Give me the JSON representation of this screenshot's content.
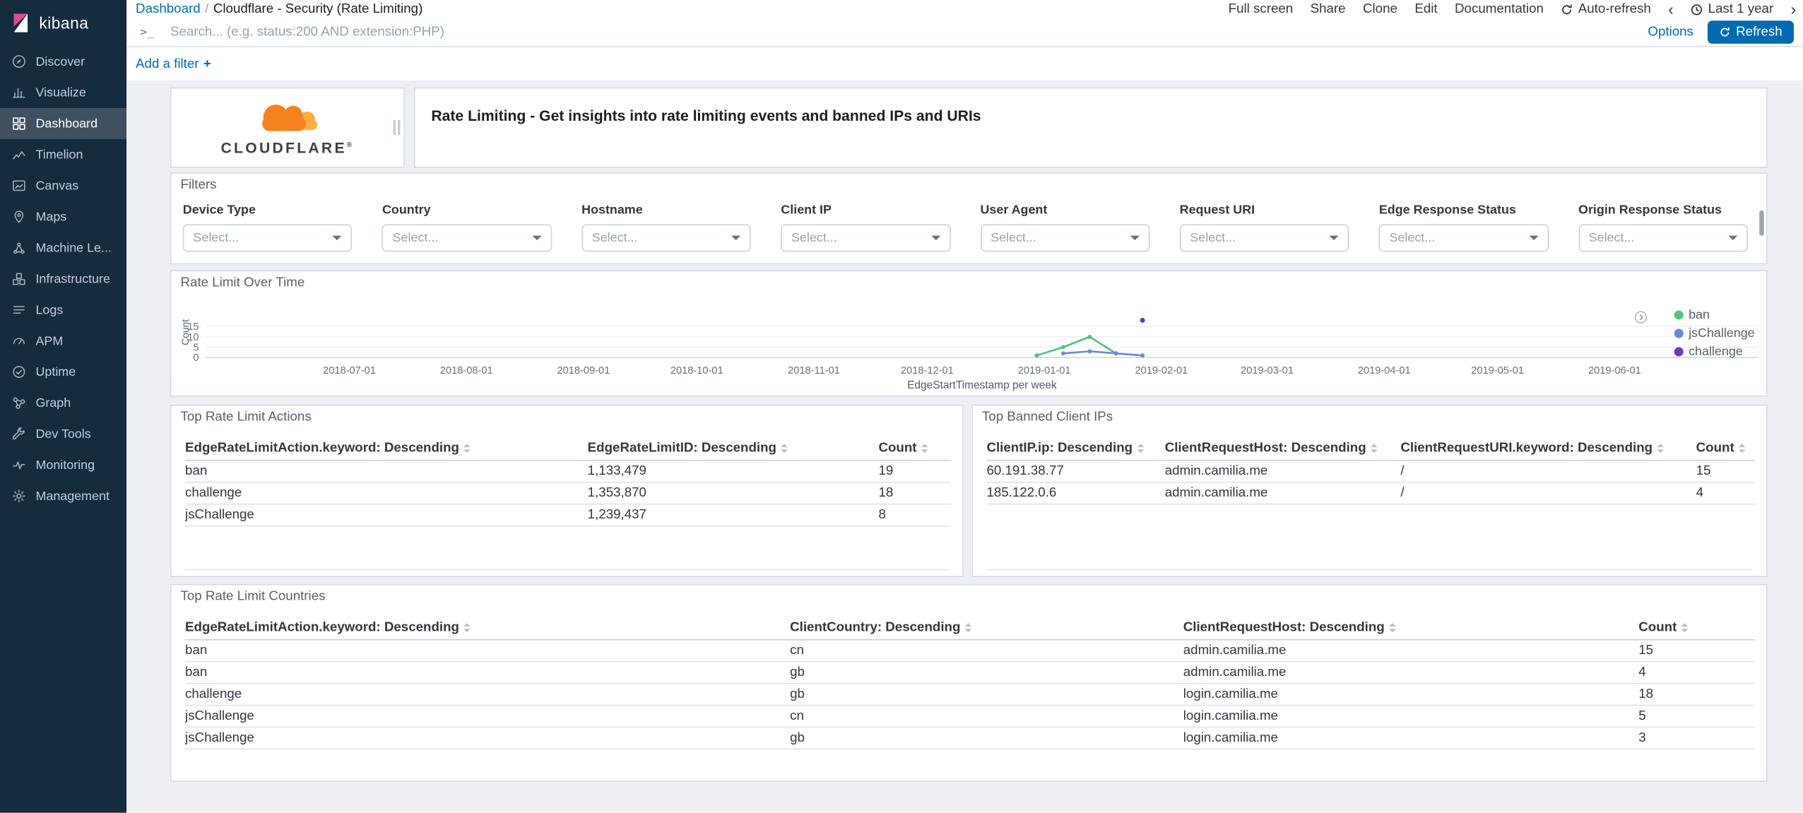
{
  "app": {
    "name": "kibana"
  },
  "sidebar": {
    "logo_label": "kibana",
    "items": [
      {
        "label": "Discover",
        "icon": "discover-icon"
      },
      {
        "label": "Visualize",
        "icon": "visualize-icon"
      },
      {
        "label": "Dashboard",
        "icon": "dashboard-icon",
        "active": true
      },
      {
        "label": "Timelion",
        "icon": "timelion-icon"
      },
      {
        "label": "Canvas",
        "icon": "canvas-icon"
      },
      {
        "label": "Maps",
        "icon": "maps-icon"
      },
      {
        "label": "Machine Le...",
        "icon": "machine-learning-icon"
      },
      {
        "label": "Infrastructure",
        "icon": "infrastructure-icon"
      },
      {
        "label": "Logs",
        "icon": "logs-icon"
      },
      {
        "label": "APM",
        "icon": "apm-icon"
      },
      {
        "label": "Uptime",
        "icon": "uptime-icon"
      },
      {
        "label": "Graph",
        "icon": "graph-icon"
      },
      {
        "label": "Dev Tools",
        "icon": "dev-tools-icon"
      },
      {
        "label": "Monitoring",
        "icon": "monitoring-icon"
      },
      {
        "label": "Management",
        "icon": "management-icon"
      }
    ]
  },
  "topnav": {
    "breadcrumb": {
      "link": "Dashboard",
      "separator": "/",
      "current": "Cloudflare - Security (Rate Limiting)"
    },
    "menu": [
      "Full screen",
      "Share",
      "Clone",
      "Edit",
      "Documentation"
    ],
    "auto_refresh": "Auto-refresh",
    "prev": "‹",
    "next": "›",
    "time_range": "Last 1 year"
  },
  "query_bar": {
    "prompt": ">_",
    "placeholder": "Search... (e.g. status:200 AND extension:PHP)",
    "options": "Options",
    "refresh": "Refresh"
  },
  "filter_bar": {
    "add_filter": "Add a filter",
    "plus": "+"
  },
  "panels": {
    "cloudflare": {
      "brand": "CLOUDFLARE",
      "reg": "®"
    },
    "markdown": {
      "text": "Rate Limiting - Get insights into rate limiting events and banned IPs and URIs"
    },
    "filters": {
      "title": "Filters",
      "fields": [
        {
          "label": "Device Type",
          "placeholder": "Select..."
        },
        {
          "label": "Country",
          "placeholder": "Select..."
        },
        {
          "label": "Hostname",
          "placeholder": "Select..."
        },
        {
          "label": "Client IP",
          "placeholder": "Select..."
        },
        {
          "label": "User Agent",
          "placeholder": "Select..."
        },
        {
          "label": "Request URI",
          "placeholder": "Select..."
        },
        {
          "label": "Edge Response Status",
          "placeholder": "Select..."
        },
        {
          "label": "Origin Response Status",
          "placeholder": "Select..."
        }
      ]
    },
    "over_time": {
      "title": "Rate Limit Over Time"
    },
    "top_actions": {
      "title": "Top Rate Limit Actions",
      "columns": [
        "EdgeRateLimitAction.keyword: Descending",
        "EdgeRateLimitID: Descending",
        "Count"
      ],
      "rows": [
        [
          "ban",
          "1,133,479",
          "19"
        ],
        [
          "challenge",
          "1,353,870",
          "18"
        ],
        [
          "jsChallenge",
          "1,239,437",
          "8"
        ]
      ]
    },
    "top_banned": {
      "title": "Top Banned Client IPs",
      "columns": [
        "ClientIP.ip: Descending",
        "ClientRequestHost: Descending",
        "ClientRequestURI.keyword: Descending",
        "Count"
      ],
      "rows": [
        [
          "60.191.38.77",
          "admin.camilia.me",
          "/",
          "15"
        ],
        [
          "185.122.0.6",
          "admin.camilia.me",
          "/",
          "4"
        ]
      ]
    },
    "top_countries": {
      "title": "Top Rate Limit Countries",
      "columns": [
        "EdgeRateLimitAction.keyword: Descending",
        "ClientCountry: Descending",
        "ClientRequestHost: Descending",
        "Count"
      ],
      "rows": [
        [
          "ban",
          "cn",
          "admin.camilia.me",
          "15"
        ],
        [
          "ban",
          "gb",
          "admin.camilia.me",
          "4"
        ],
        [
          "challenge",
          "gb",
          "login.camilia.me",
          "18"
        ],
        [
          "jsChallenge",
          "cn",
          "login.camilia.me",
          "5"
        ],
        [
          "jsChallenge",
          "gb",
          "login.camilia.me",
          "3"
        ]
      ]
    }
  },
  "chart_data": {
    "type": "line",
    "title": "Rate Limit Over Time",
    "xlabel": "EdgeStartTimestamp per week",
    "ylabel": "Count",
    "ylim": [
      0,
      20
    ],
    "yticks": [
      0,
      5,
      10,
      15
    ],
    "xticks": [
      "2018-07-01",
      "2018-08-01",
      "2018-09-01",
      "2018-10-01",
      "2018-11-01",
      "2018-12-01",
      "2019-01-01",
      "2019-02-01",
      "2019-03-01",
      "2019-04-01",
      "2019-05-01",
      "2019-06-01"
    ],
    "x_domain": [
      "2018-05-24",
      "2019-07-09"
    ],
    "legend_position": "right",
    "grid": false,
    "series": [
      {
        "name": "ban",
        "color": "#57c17b",
        "points": [
          [
            "2018-12-30",
            1
          ],
          [
            "2019-01-06",
            5
          ],
          [
            "2019-01-13",
            10
          ],
          [
            "2019-01-20",
            2
          ],
          [
            "2019-01-27",
            1
          ]
        ]
      },
      {
        "name": "jsChallenge",
        "color": "#6f87d8",
        "points": [
          [
            "2019-01-06",
            2
          ],
          [
            "2019-01-13",
            3
          ],
          [
            "2019-01-20",
            2
          ],
          [
            "2019-01-27",
            1
          ]
        ]
      },
      {
        "name": "challenge",
        "color": "#663db8",
        "points": [
          [
            "2019-01-27",
            18
          ]
        ]
      }
    ]
  },
  "colors": {
    "primary": "#006bb4",
    "sidebar_bg": "#152b3e",
    "cloudflare_orange": "#f6821f",
    "cloudflare_orange_light": "#fbad41",
    "kibana_pink": "#e8488b"
  }
}
